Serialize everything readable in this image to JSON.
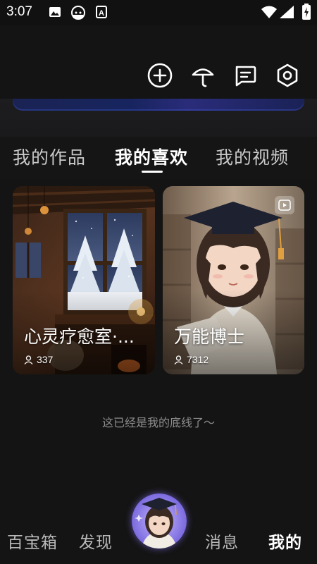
{
  "status_bar": {
    "time": "3:07",
    "left_icons": [
      "image-icon",
      "android-icon",
      "font-a-icon"
    ],
    "right_icons": [
      "wifi-icon",
      "signal-icon",
      "battery-charging-icon"
    ]
  },
  "top_actions": [
    {
      "name": "add-circle-icon"
    },
    {
      "name": "umbrella-icon"
    },
    {
      "name": "message-icon"
    },
    {
      "name": "settings-icon"
    }
  ],
  "tabs": [
    {
      "label": "我的作品",
      "active": false
    },
    {
      "label": "我的喜欢",
      "active": true
    },
    {
      "label": "我的视频",
      "active": false
    }
  ],
  "cards": [
    {
      "title": "心灵疗愈室·...",
      "count": "337"
    },
    {
      "title": "万能博士",
      "count": "7312"
    }
  ],
  "footer_note": "这已经是我的底线了〜",
  "bottom_nav": {
    "items": [
      {
        "label": "百宝箱",
        "active": false
      },
      {
        "label": "发现",
        "active": false
      },
      {
        "label": "消息",
        "active": false
      },
      {
        "label": "我的",
        "active": true
      }
    ]
  },
  "colors": {
    "background": "#141414",
    "text_active": "#ffffff",
    "text_inactive": "#c9c9c9",
    "muted": "#8e8e8e"
  }
}
